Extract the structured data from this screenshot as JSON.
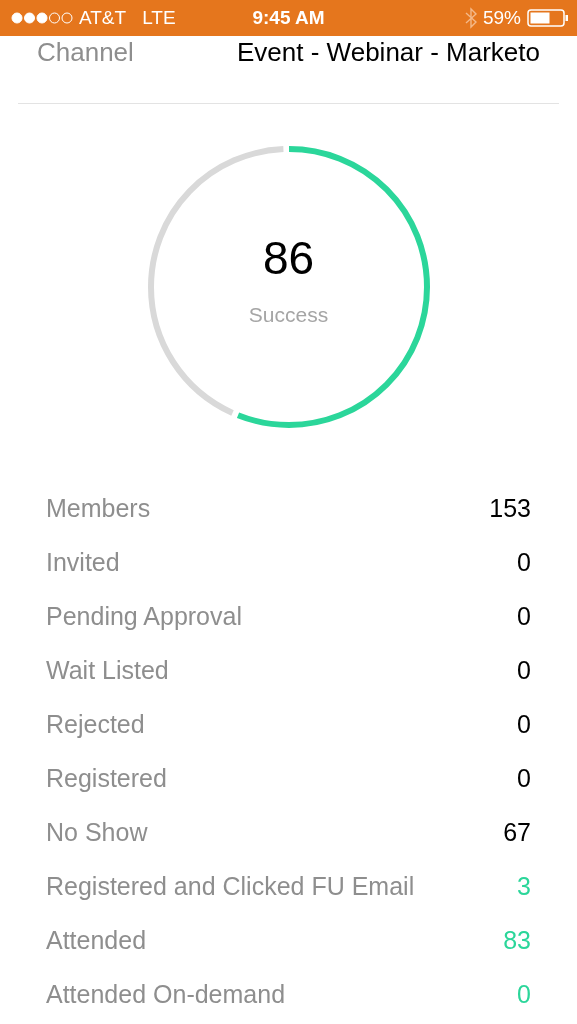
{
  "status_bar": {
    "carrier": "AT&T",
    "network": "LTE",
    "time": "9:45 AM",
    "battery": "59%"
  },
  "header": {
    "label": "Channel",
    "value": "Event - Webinar - Marketo"
  },
  "gauge": {
    "value": "86",
    "label": "Success"
  },
  "stats": [
    {
      "label": "Members",
      "value": "153",
      "color": "#000000"
    },
    {
      "label": "Invited",
      "value": "0",
      "color": "#000000"
    },
    {
      "label": "Pending Approval",
      "value": "0",
      "color": "#000000"
    },
    {
      "label": "Wait Listed",
      "value": "0",
      "color": "#000000"
    },
    {
      "label": "Rejected",
      "value": "0",
      "color": "#000000"
    },
    {
      "label": "Registered",
      "value": "0",
      "color": "#000000"
    },
    {
      "label": "No Show",
      "value": "67",
      "color": "#000000"
    },
    {
      "label": "Registered and Clicked FU Email",
      "value": "3",
      "color": "#2bd69a"
    },
    {
      "label": "Attended",
      "value": "83",
      "color": "#2bd69a"
    },
    {
      "label": "Attended On-demand",
      "value": "0",
      "color": "#2bd69a"
    }
  ]
}
